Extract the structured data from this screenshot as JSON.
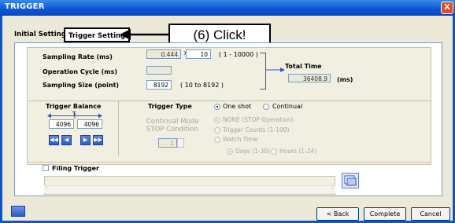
{
  "window": {
    "title": "TRIGGER",
    "close_glyph": "X"
  },
  "tabs": [
    {
      "label": "Initial Setting"
    },
    {
      "label": "Trigger Setting"
    }
  ],
  "callout": {
    "text": "(6) Click!"
  },
  "sampling": {
    "rate_label": "Sampling Rate (ms)",
    "rate_base": "0.444",
    "multiply": "×",
    "rate_multiplier": "10",
    "rate_range": "( 1 - 10000 )",
    "cycle_label": "Operation Cycle (ms)",
    "size_label": "Sampling Size (point)",
    "size_value": "8192",
    "size_range": "( 10 to 8192 )"
  },
  "total_time": {
    "label": "Total Time",
    "value": "36408.9",
    "unit": "(ms)"
  },
  "trigger_balance": {
    "label": "Trigger Balance",
    "marker": "T",
    "left_value": "4096",
    "right_value": "4096"
  },
  "nav_buttons": [
    "◀◀",
    "◀",
    "▶",
    "▶▶"
  ],
  "trigger_type": {
    "label": "Trigger Type",
    "options": [
      {
        "label": "One shot",
        "selected": true
      },
      {
        "label": "Continual",
        "selected": false
      }
    ]
  },
  "continual_mode": {
    "title_line1": "Continual Mode",
    "title_line2": "STOP Condition",
    "spin_value": "1",
    "options": [
      {
        "label": "NONE   (STOP Operation)",
        "selected": true
      },
      {
        "label": "Trigger Counts   (1-100)",
        "selected": false
      },
      {
        "label": "Watch Time",
        "selected": false
      }
    ],
    "time_options": [
      {
        "label": "Days (1-30)",
        "selected": true
      },
      {
        "label": "Hours (1-24)",
        "selected": false
      }
    ]
  },
  "filing_trigger": {
    "label": "Filing Trigger",
    "checked": false
  },
  "footer": {
    "back": "< Back",
    "complete": "Complete",
    "cancel": "Cancel"
  },
  "colors": {
    "titlebar": "#0a55d6",
    "accent_arrow": "#3355cc",
    "nav_button": "#2f5cc7"
  }
}
